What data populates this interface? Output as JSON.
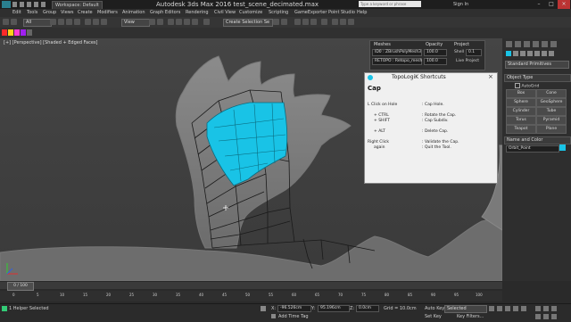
{
  "titlebar": {
    "workspace": "Workspace: Default",
    "title": "Autodesk 3ds Max 2016     test_scene_decimated.max",
    "search_placeholder": "Type a keyword or phrase",
    "sign_in": "Sign In"
  },
  "menubar": [
    "Edit",
    "Tools",
    "Group",
    "Views",
    "Create",
    "Modifiers",
    "Animation",
    "Graph Editors",
    "Rendering",
    "Civil View",
    "Customize",
    "Scripting",
    "GameExporter",
    "Point Studio",
    "Help"
  ],
  "toolbar": {
    "filter_value": "All",
    "ref_coord": "View",
    "selection_set": "Create Selection Se"
  },
  "viewport": {
    "label": "[+] [Perspective] [Shaded + Edged Faces]"
  },
  "floating_panel": {
    "meshes_label": "Meshes",
    "mesh1": "ID0 : ZBrushPolyMesh3",
    "mesh2": "RETOPO : Retopo_mesh",
    "opacity_label": "Opacity",
    "opacity1": "100.0",
    "opacity2": "100.0",
    "project_label": "Project",
    "shell_label": "Shell",
    "shell_value": "0.1",
    "live_project": "Live Project"
  },
  "shortcuts": {
    "window_title": "TopoLogiK Shortcuts",
    "section": "Cap",
    "rows": [
      {
        "key": "L Click on Hole",
        "action": ": Cap Hole."
      },
      {
        "key": "+ CTRL",
        "action": ": Rotate the Cap."
      },
      {
        "key": "+ SHIFT",
        "action": ": Cap Subdiv."
      },
      {
        "key": "+ ALT",
        "action": ": Delete Cap."
      },
      {
        "key": "Right Click",
        "action": ": Validate the Cap."
      },
      {
        "key": "again",
        "action": ": Quit the Tool."
      }
    ]
  },
  "command_panel": {
    "category": "Standard Primitives",
    "object_type_header": "Object Type",
    "autogrid": "AutoGrid",
    "buttons": [
      "Box",
      "Cone",
      "Sphere",
      "GeoSphere",
      "Cylinder",
      "Tube",
      "Torus",
      "Pyramid",
      "Teapot",
      "Plane"
    ],
    "name_color_header": "Name and Color",
    "object_name": "Orbit_Point",
    "object_color": "#19c3e6"
  },
  "timeline": {
    "frame_counter": "0 / 100",
    "ticks": [
      "0",
      "5",
      "10",
      "15",
      "20",
      "25",
      "30",
      "35",
      "40",
      "45",
      "50",
      "55",
      "60",
      "65",
      "70",
      "75",
      "80",
      "85",
      "90",
      "95",
      "100"
    ]
  },
  "status": {
    "selection": "1 Helper Selected",
    "x_label": "X:",
    "x_value": "-96.526cm",
    "y_label": "Y:",
    "y_value": "95.196cm",
    "z_label": "Z:",
    "z_value": "0.0cm",
    "grid": "Grid = 10.0cm",
    "auto_key": "Auto Key",
    "set_key": "Set Key",
    "selected": "Selected",
    "key_filters": "Key Filters...",
    "add_time_tag": "Add Time Tag"
  },
  "colors": {
    "accent": "#19c3e6",
    "mesh": "#9a9a9a",
    "viewport_bg": "#404040"
  }
}
